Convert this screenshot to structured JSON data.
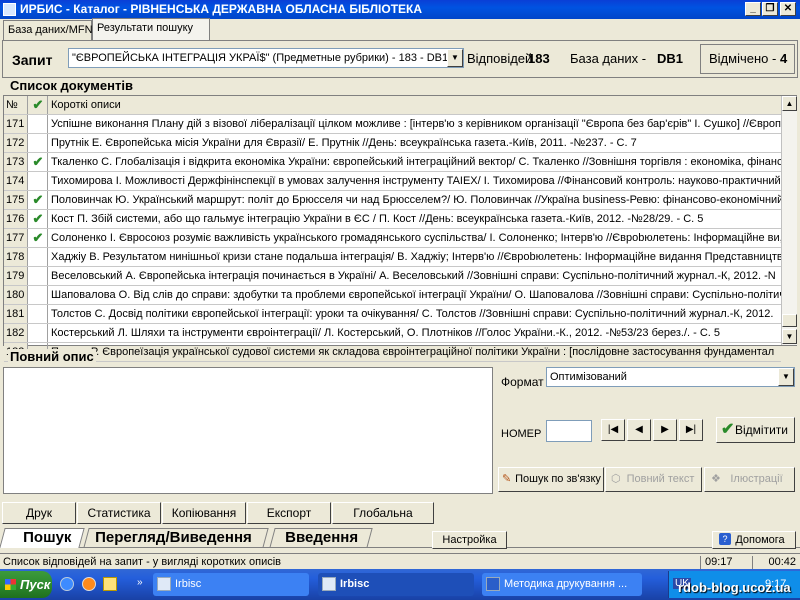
{
  "window": {
    "title": "ИРБИС - Каталог - РІВНЕНСЬКА ДЕРЖАВНА ОБЛАСНА БІБЛІОТЕКА",
    "min_label": "_",
    "max_label": "❐",
    "close_label": "✕"
  },
  "tabs": [
    "База даних/MFN",
    "Результати пошуку"
  ],
  "query": {
    "label": "Запит",
    "value": "\"ЄВРОПЕЙСЬКА ІНТЕГРАЦІЯ УКРАЇ$\" (Предметные рубрики) - 183 - DB1",
    "results_label": "Відповідей",
    "results_count": "183",
    "db_label": "База даних -",
    "db_value": "DB1",
    "marked_label": "Відмічено -",
    "marked_count": "4"
  },
  "list": {
    "title": "Список документів",
    "col_num": "№",
    "col_desc": "Короткі описи",
    "rows": [
      {
        "num": "171",
        "checked": false,
        "desc": "Успішне виконання Плану дій з візової лібералізації цілком можливе : [інтерв'ю з керівником організації \"Європа без бар'єрів\" І. Сушко] //Європолі"
      },
      {
        "num": "172",
        "checked": false,
        "desc": "Прутнік Е. Європейська місія України для Євразії/ Е. Прутнік //День: всеукраїнська газета.-Київ, 2011. -№237. -  С. 7"
      },
      {
        "num": "173",
        "checked": true,
        "desc": "Ткаленко С. Глобалізація і відкрита економіка України: європейський інтеграційний вектор/ С. Ткаленко //Зовнішня торгівля : економіка, фінанси"
      },
      {
        "num": "174",
        "checked": false,
        "desc": "Тихомирова І. Можливості Держфінінспекції в умовах залучення інструменту TAIEX/ І. Тихомирова //Фінансовий контроль: науково-практичний"
      },
      {
        "num": "175",
        "checked": true,
        "desc": "Половинчак Ю. Український маршрут: політ до Брюсселя чи над Брюсселем?/ Ю. Половинчак //Україна business-Ревю: фінансово-економічний"
      },
      {
        "num": "176",
        "checked": true,
        "desc": "Кост П. Збій системи, або що гальмує інтеграцію України в ЄС / П. Кост //День: всеукраїнська газета.-Київ, 2012. -№28/29. -  С. 5"
      },
      {
        "num": "177",
        "checked": true,
        "desc": "Солоненко І. Євросоюз розуміє важливість українського громадянського суспільства/ І. Солоненко; Інтерв'ю //Єврobюлетень: Інформаційне ви,"
      },
      {
        "num": "178",
        "checked": false,
        "desc": "Хаджіу В. Результатом нинішньої кризи стане подальша інтеграція/ В. Хаджіу; Інтерв'ю //Єврobюлетень: Інформаційне видання Представництв"
      },
      {
        "num": "179",
        "checked": false,
        "desc": "Веселовський А. Європейська інтеграція починається в Україні/ А. Веселовський //Зовнішні справи: Суспільно-політичний журнал.-К, 2012. -N"
      },
      {
        "num": "180",
        "checked": false,
        "desc": "Шаповалова О. Від слів до справи: здобутки та проблеми європейської інтеграції України/ О. Шаповалова //Зовнішні справи: Суспільно-політичн"
      },
      {
        "num": "181",
        "checked": false,
        "desc": "Толстов С. Досвід політики європейської інтеграції: уроки та очікування/ С. Толстов //Зовнішні справи: Суспільно-політичний журнал.-К, 2012."
      },
      {
        "num": "182",
        "checked": false,
        "desc": "Костерський Л. Шляхи та інструменти євроінтеграції/ Л. Костерський, О. Плотніков //Голос України.-К., 2012. -№53/23 берез./. -  С. 5"
      },
      {
        "num": "183",
        "checked": false,
        "desc": "Петров Р. Європеїзація української судової системи як складова євроінтеграційної політики України : [послідовне застосування фундаментал"
      }
    ]
  },
  "full_desc": {
    "title": "Повний опис",
    "format_label": "Формат",
    "format_value": "Оптимізований",
    "nomer_label": "НОМЕР",
    "nomer_value": "",
    "mark_button": "Відмітити",
    "link_search": "Пошук по зв'язку",
    "full_text": "Повний текст",
    "illustrations": "Ілюстрації"
  },
  "actions": [
    "Друк",
    "Статистика",
    "Копіювання",
    "Експорт",
    "Глобальна"
  ],
  "bottom_tabs": [
    "Пошук",
    "Перегляд/Виведення",
    "Введення"
  ],
  "settings_button": "Настройка",
  "help_button": "Допомога",
  "status": {
    "text": "Список відповідей на запит - у вигляді коротких описів",
    "time1": "09:17",
    "time2": "00:42"
  },
  "taskbar": {
    "start": "Пуск",
    "items": [
      "Irbisc",
      "Irbisc",
      "Методика друкування ..."
    ],
    "lang": "UK",
    "clock": "9:17",
    "watermark": "rdob-blog.ucoz.ua"
  },
  "colors": {
    "titlebar": "#0053e1",
    "check": "#2a8a2a",
    "taskbar": "#245edb",
    "start": "#2d8a2d"
  }
}
